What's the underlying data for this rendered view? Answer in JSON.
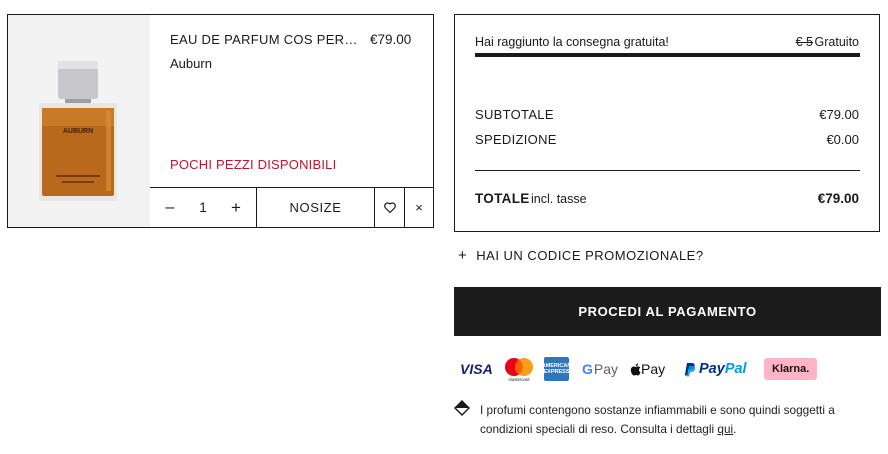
{
  "cart_item": {
    "name": "EAU DE PARFUM COS PERF...",
    "price": "€79.00",
    "variant": "Auburn",
    "stock_warning": "POCHI PEZZI DISPONIBILI",
    "bottle_label": "AUBURN",
    "quantity_minus": "–",
    "quantity": "1",
    "quantity_plus": "+",
    "size_label": "NOSIZE",
    "remove_label": "×"
  },
  "summary": {
    "shipping_message": "Hai raggiunto la consegna gratuita!",
    "shipping_old_price": "€ 5",
    "shipping_free_label": "Gratuito",
    "free_shipping_progress": 1.0,
    "subtotal_label": "SUBTOTALE",
    "subtotal_value": "€79.00",
    "shipping_label": "SPEDIZIONE",
    "shipping_value": "€0.00",
    "total_label": "TOTALE",
    "total_tax_note": "incl. tasse",
    "total_value": "€79.00"
  },
  "promo": {
    "plus": "+",
    "label": "HAI UN CODICE PROMOZIONALE?"
  },
  "checkout": {
    "label": "PROCEDI AL PAGAMENTO"
  },
  "payment_methods": {
    "visa": "VISA",
    "mastercard": "mastercard",
    "amex_line1": "AMERICAN",
    "amex_line2": "EXPRESS",
    "gpay_g": "G",
    "gpay_text": "Pay",
    "apple_pay": " Pay",
    "paypal_1": "Pay",
    "paypal_2": "Pal",
    "klarna": "Klarna."
  },
  "note": {
    "text": "I profumi contengono sostanze infiammabili e sono quindi soggetti a condizioni speciali di reso. Consulta i dettagli ",
    "link_label": "qui",
    "end": "."
  },
  "colors": {
    "accent_dark": "#1c1c1c",
    "stock_warning": "#c0142a",
    "klarna_pink": "#ffb3c7"
  },
  "icons": [
    "heart-icon",
    "close-icon",
    "diamond-warning-icon",
    "mastercard-logo",
    "apple-logo"
  ]
}
